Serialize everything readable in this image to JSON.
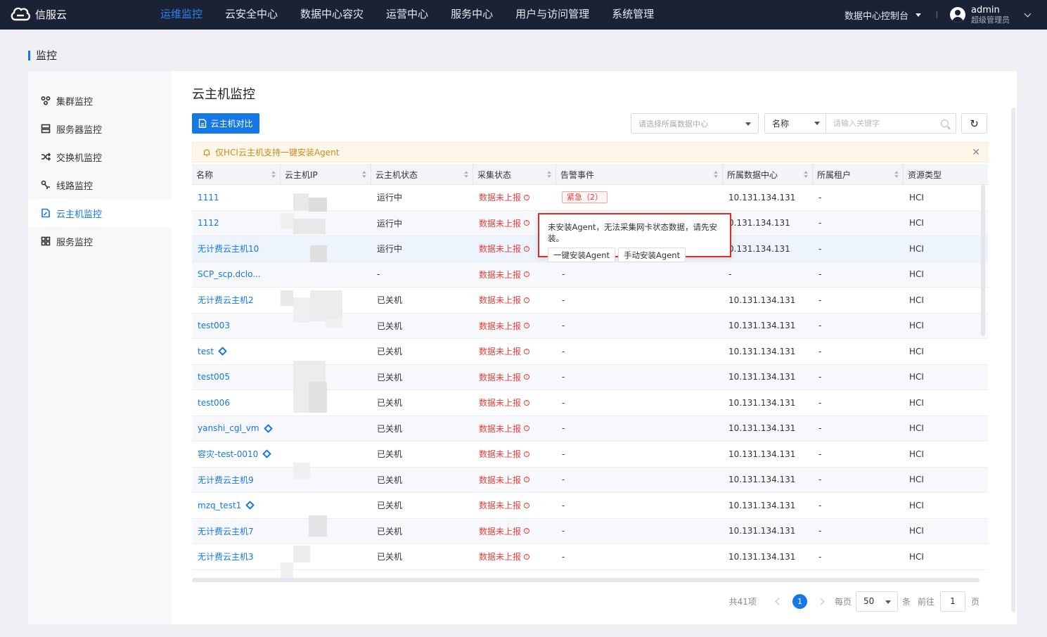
{
  "brand": {
    "name": "信服云"
  },
  "nav": {
    "items": [
      "运维监控",
      "云安全中心",
      "数据中心容灾",
      "运营中心",
      "服务中心",
      "用户与访问管理",
      "系统管理"
    ],
    "active_index": 0
  },
  "header": {
    "console_label": "数据中心控制台",
    "user_name": "admin",
    "user_role": "超级管理员"
  },
  "breadcrumb": {
    "title": "监控"
  },
  "sidebar": {
    "items": [
      {
        "label": "集群监控",
        "icon": "cluster-icon"
      },
      {
        "label": "服务器监控",
        "icon": "server-icon"
      },
      {
        "label": "交换机监控",
        "icon": "switch-icon"
      },
      {
        "label": "线路监控",
        "icon": "link-icon"
      },
      {
        "label": "云主机监控",
        "icon": "vm-icon"
      },
      {
        "label": "服务监控",
        "icon": "service-icon"
      }
    ],
    "active_index": 4
  },
  "main": {
    "title": "云主机监控",
    "compare_button": "云主机对比",
    "datacenter_placeholder": "请选择所属数据中心",
    "search_field": "名称",
    "search_placeholder": "请输入关键字",
    "alert_text": "仅HCI云主机支持一键安装Agent"
  },
  "table": {
    "columns": [
      "名称",
      "云主机IP",
      "云主机状态",
      "采集状态",
      "告警事件",
      "所属数据中心",
      "所属租户",
      "资源类型"
    ],
    "rows": [
      {
        "name": "1111",
        "status": "运行中",
        "collect": "数据未上报",
        "alarm": "紧急（2）",
        "dc": "10.131.134.131",
        "tenant": "-",
        "type": "HCI"
      },
      {
        "name": "1112",
        "status": "运行中",
        "collect": "数据未上报",
        "alarm": "",
        "dc": "0.131.134.131",
        "tenant": "-",
        "type": "HCI"
      },
      {
        "name": "无计费云主机10",
        "status": "运行中",
        "collect": "数据未上报",
        "alarm": "",
        "dc": "0.131.134.131",
        "tenant": "-",
        "type": "HCI"
      },
      {
        "name": "SCP_scp.dclo...",
        "status": "-",
        "collect": "数据未上报",
        "alarm": "-",
        "dc": "-",
        "tenant": "-",
        "type": "HCI"
      },
      {
        "name": "无计费云主机2",
        "status": "已关机",
        "collect": "数据未上报",
        "alarm": "-",
        "dc": "10.131.134.131",
        "tenant": "-",
        "type": "HCI"
      },
      {
        "name": "test003",
        "status": "已关机",
        "collect": "数据未上报",
        "alarm": "-",
        "dc": "10.131.134.131",
        "tenant": "-",
        "type": "HCI"
      },
      {
        "name": "test",
        "status": "已关机",
        "collect": "数据未上报",
        "alarm": "-",
        "dc": "10.131.134.131",
        "tenant": "-",
        "type": "HCI"
      },
      {
        "name": "test005",
        "status": "已关机",
        "collect": "数据未上报",
        "alarm": "-",
        "dc": "10.131.134.131",
        "tenant": "-",
        "type": "HCI"
      },
      {
        "name": "test006",
        "status": "已关机",
        "collect": "数据未上报",
        "alarm": "-",
        "dc": "10.131.134.131",
        "tenant": "-",
        "type": "HCI"
      },
      {
        "name": "yanshi_cgl_vm",
        "status": "已关机",
        "collect": "数据未上报",
        "alarm": "-",
        "dc": "10.131.134.131",
        "tenant": "-",
        "type": "HCI"
      },
      {
        "name": "容灾-test-0010",
        "status": "已关机",
        "collect": "数据未上报",
        "alarm": "-",
        "dc": "10.131.134.131",
        "tenant": "-",
        "type": "HCI"
      },
      {
        "name": "无计费云主机9",
        "status": "已关机",
        "collect": "数据未上报",
        "alarm": "-",
        "dc": "10.131.134.131",
        "tenant": "-",
        "type": "HCI"
      },
      {
        "name": "mzq_test1",
        "status": "已关机",
        "collect": "数据未上报",
        "alarm": "-",
        "dc": "10.131.134.131",
        "tenant": "-",
        "type": "HCI"
      },
      {
        "name": "无计费云主机7",
        "status": "已关机",
        "collect": "数据未上报",
        "alarm": "-",
        "dc": "10.131.134.131",
        "tenant": "-",
        "type": "HCI"
      },
      {
        "name": "无计费云主机3",
        "status": "已关机",
        "collect": "数据未上报",
        "alarm": "-",
        "dc": "10.131.134.131",
        "tenant": "-",
        "type": "HCI"
      }
    ]
  },
  "popover": {
    "message": "未安装Agent，无法采集网卡状态数据，请先安装。",
    "one_click_button": "一键安装Agent",
    "manual_button": "手动安装Agent"
  },
  "pagination": {
    "total": "共41项",
    "current_page": "1",
    "per_page_label": "每页",
    "page_size": "50",
    "unit": "条",
    "goto_label": "前往",
    "goto_value": "1",
    "page_suffix": "页"
  }
}
